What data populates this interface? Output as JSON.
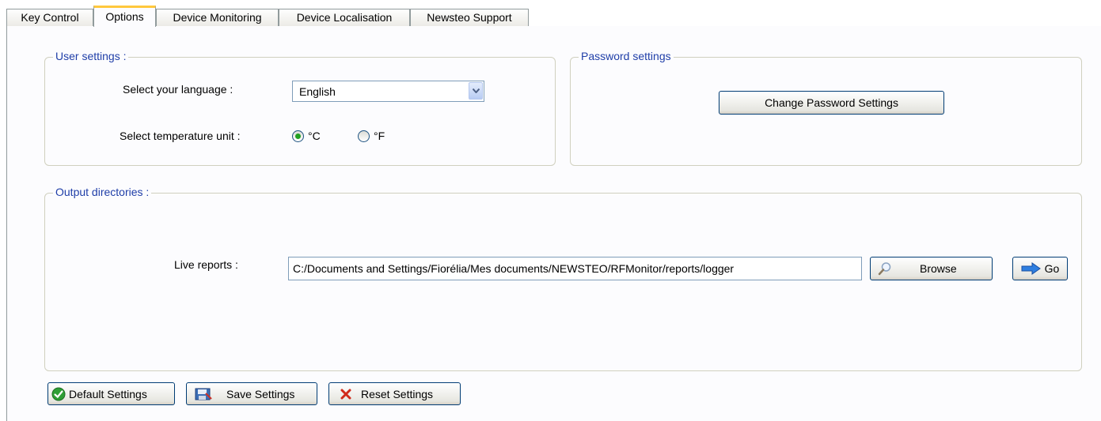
{
  "tabs": [
    {
      "label": "Key Control",
      "active": false
    },
    {
      "label": "Options",
      "active": true
    },
    {
      "label": "Device Monitoring",
      "active": false
    },
    {
      "label": "Device Localisation",
      "active": false
    },
    {
      "label": "Newsteo Support",
      "active": false
    }
  ],
  "user_settings": {
    "legend": "User settings :",
    "language_label": "Select your language :",
    "language_value": "English",
    "temperature_label": "Select temperature unit :",
    "temperature_options": [
      {
        "label": "°C",
        "selected": true
      },
      {
        "label": "°F",
        "selected": false
      }
    ]
  },
  "password_settings": {
    "legend": "Password settings",
    "button_label": "Change Password Settings"
  },
  "output_directories": {
    "legend": "Output directories :",
    "live_reports_label": "Live reports :",
    "live_reports_path": "C:/Documents and Settings/Fiorélia/Mes documents/NEWSTEO/RFMonitor/reports/logger",
    "browse_label": "Browse",
    "go_label": "Go"
  },
  "footer": {
    "default_label": "Default Settings",
    "save_label": "Save Settings",
    "reset_label": "Reset Settings"
  },
  "colors": {
    "legend": "#1f3ea8",
    "tab_highlight": "#ffc83c",
    "radio_dot": "#21a121"
  },
  "icons": {
    "default": "check-circle-icon",
    "save": "save-icon",
    "reset": "red-x-icon",
    "browse": "magnifier-icon",
    "go": "arrow-right-icon"
  }
}
